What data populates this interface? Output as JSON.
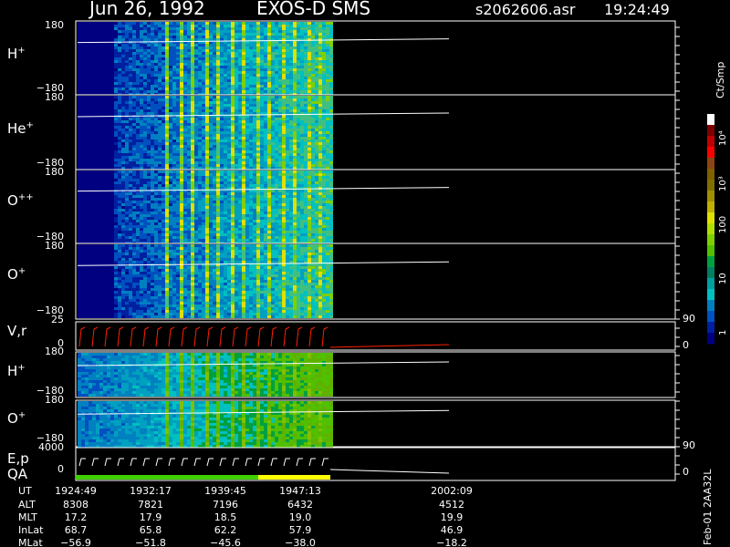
{
  "header": {
    "date": "Jun 26, 1992",
    "instrument": "EXOS-D SMS",
    "file": "s2062606.asr",
    "time": "19:24:49"
  },
  "panels": {
    "hplus": {
      "label": "H",
      "sup": "+",
      "ytop": "180",
      "ybot": "−180"
    },
    "heplus": {
      "label": "He",
      "sup": "+",
      "ytop": "180",
      "ybot": "−180"
    },
    "oplusplus": {
      "label": "O",
      "sup": "++",
      "ytop": "180",
      "ybot": "−180"
    },
    "oplus": {
      "label": "O",
      "sup": "+",
      "ytop": "180",
      "ybot": "−180"
    },
    "vr": {
      "label": "V,r",
      "ytop": "25",
      "ybot": "0",
      "rtop": "90",
      "rbot": "0"
    },
    "hplus2": {
      "label": "H",
      "sup": "+",
      "ytop": "180",
      "ybot": "−180"
    },
    "oplus2": {
      "label": "O",
      "sup": "+",
      "ytop": "180",
      "ybot": "−180"
    },
    "ep": {
      "label1": "E,p",
      "label2": "QA",
      "ytop": "4000",
      "ybot": "0",
      "rtop": "90",
      "rbot": "0"
    }
  },
  "colorbar": {
    "unit": "Ct/Smp",
    "ticks": [
      "10⁴",
      "10³",
      "100",
      "10",
      "1"
    ],
    "colors": [
      "#ffffff",
      "#800000",
      "#c00000",
      "#ff0000",
      "#8b4513",
      "#806000",
      "#807000",
      "#a09000",
      "#c0b000",
      "#e0e000",
      "#b0e000",
      "#80d000",
      "#50c000",
      "#00a040",
      "#008060",
      "#00a0a0",
      "#00c0c0",
      "#0080c0",
      "#0050c0",
      "#0020a0",
      "#000080"
    ]
  },
  "ephemeris": {
    "labels": [
      "UT",
      "ALT",
      "MLT",
      "InLat",
      "MLat"
    ],
    "columns": [
      {
        "UT": "1924:49",
        "ALT": "8308",
        "MLT": "17.2",
        "InLat": "68.7",
        "MLat": "−56.9"
      },
      {
        "UT": "1932:17",
        "ALT": "7821",
        "MLT": "17.9",
        "InLat": "65.8",
        "MLat": "−51.8"
      },
      {
        "UT": "1939:45",
        "ALT": "7196",
        "MLT": "18.5",
        "InLat": "62.2",
        "MLat": "−45.6"
      },
      {
        "UT": "1947:13",
        "ALT": "6432",
        "MLT": "19.0",
        "InLat": "57.9",
        "MLat": "−38.0"
      },
      {
        "UT": "2002:09",
        "ALT": "4512",
        "MLT": "19.9",
        "InLat": "46.9",
        "MLat": "−18.2"
      }
    ]
  },
  "footer": {
    "stamp": "Feb-01 2AA32L"
  },
  "chart_data": {
    "type": "heatmap",
    "title": "Jun 26, 1992   EXOS-D SMS",
    "x_ticks": [
      "1924:49",
      "1932:17",
      "1939:45",
      "1947:13",
      "2002:09"
    ],
    "y_range": [
      -180,
      180
    ],
    "series": [
      {
        "name": "H+"
      },
      {
        "name": "He+"
      },
      {
        "name": "O++"
      },
      {
        "name": "O+"
      },
      {
        "name": "H+"
      },
      {
        "name": "O+"
      }
    ],
    "colorbar": {
      "unit": "Ct/Smp",
      "range": [
        1,
        10000
      ],
      "scale": "log"
    },
    "data_coverage": {
      "start": "1924:49",
      "end": "1947:13"
    }
  }
}
